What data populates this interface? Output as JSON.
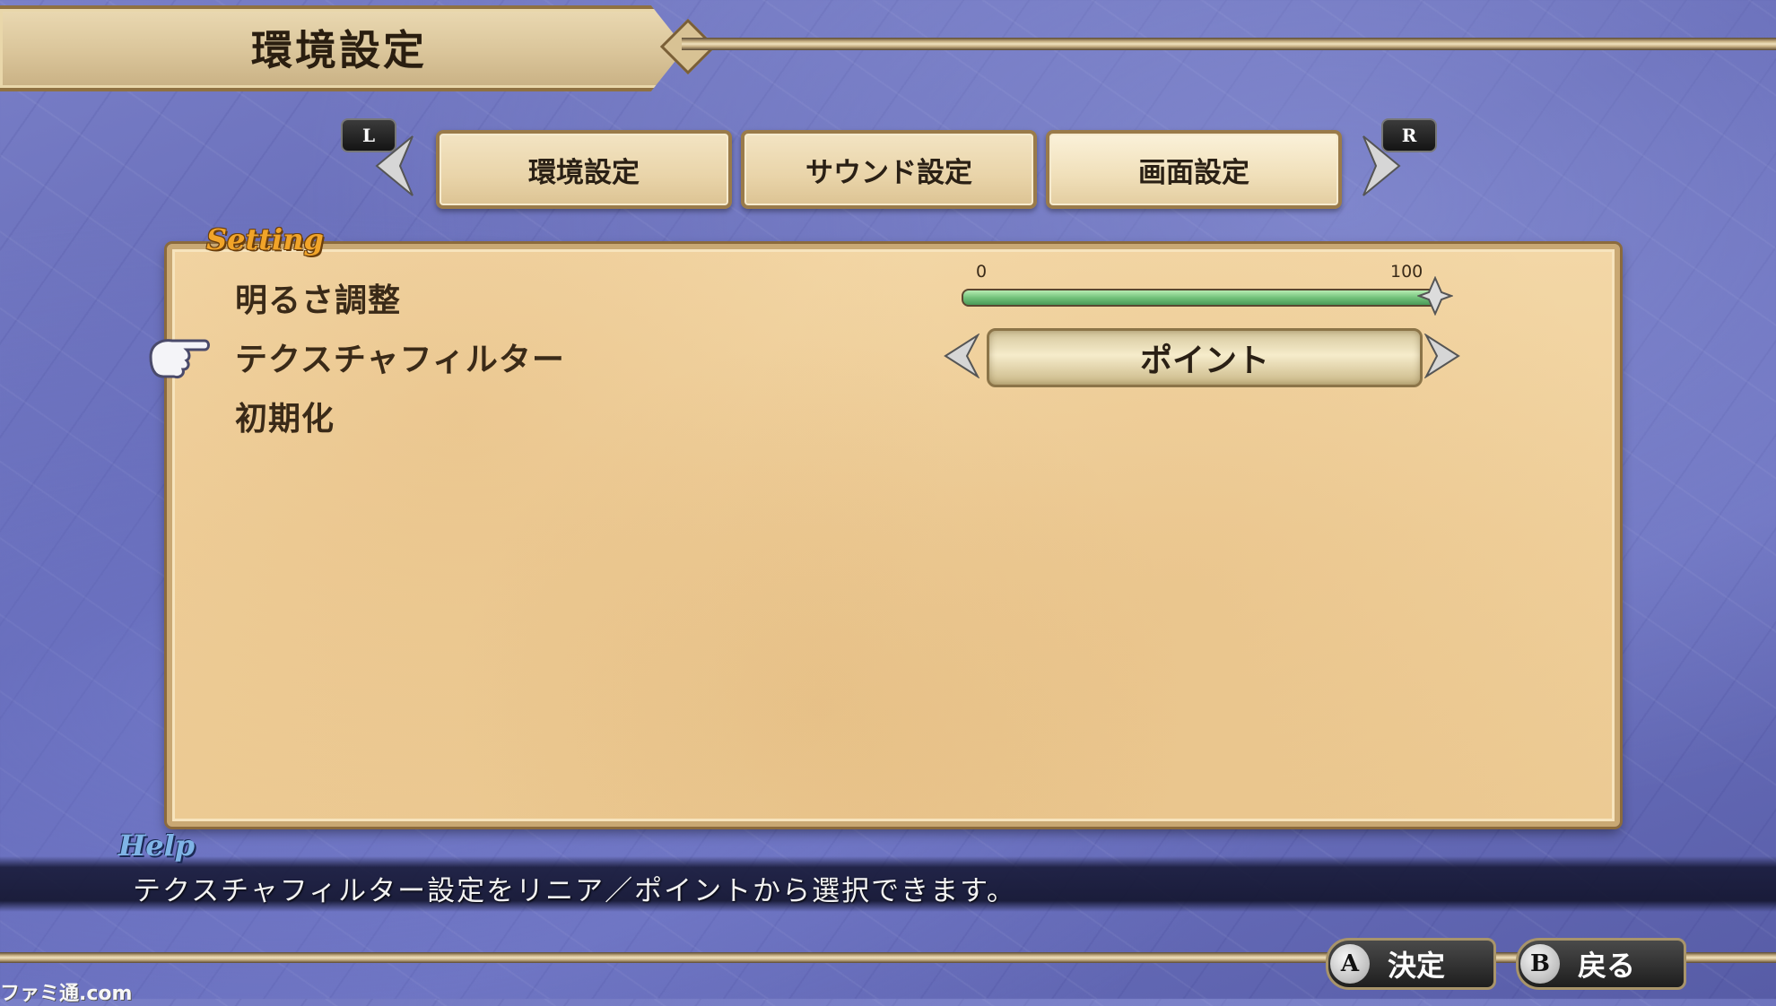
{
  "header": {
    "title": "環境設定"
  },
  "tabs": {
    "left_shoulder": "L",
    "right_shoulder": "R",
    "items": [
      {
        "label": "環境設定"
      },
      {
        "label": "サウンド設定"
      },
      {
        "label": "画面設定"
      }
    ],
    "active_index": 2
  },
  "panel": {
    "section_label": "Setting",
    "items": [
      {
        "label": "明るさ調整"
      },
      {
        "label": "テクスチャフィルター"
      },
      {
        "label": "初期化"
      }
    ],
    "selected_index": 1,
    "brightness": {
      "min_label": "0",
      "max_label": "100",
      "value_fraction": 1.0
    },
    "texture_filter": {
      "value": "ポイント"
    }
  },
  "help": {
    "label": "Help",
    "text": "テクスチャフィルター設定をリニア／ポイントから選択できます。"
  },
  "footer": {
    "confirm": {
      "key": "A",
      "label": "決定"
    },
    "back": {
      "key": "B",
      "label": "戻る"
    }
  },
  "watermark": "ファミ通.com",
  "colors": {
    "panel": "#efcf9a",
    "slider_fill": "#73c27a",
    "setting_label": "#f1a429",
    "help_label": "#7fb4e6"
  },
  "icons": [
    "chevron-left-icon",
    "chevron-right-icon",
    "pointing-hand-icon",
    "diamond-knob-icon"
  ]
}
